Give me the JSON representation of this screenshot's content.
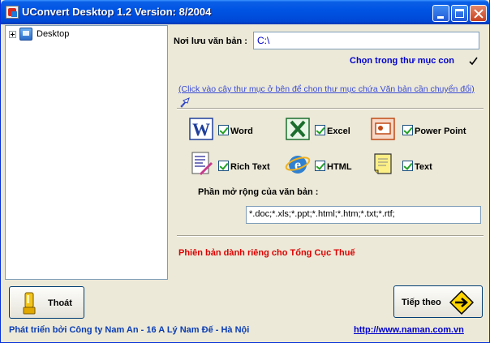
{
  "window": {
    "title": "UConvert Desktop 1.2   Version: 8/2004"
  },
  "tree": {
    "root_label": "Desktop"
  },
  "folder": {
    "label": "Nơi lưu văn bản :",
    "value": "C:\\",
    "subfolder_label": "Chọn trong thư mục con",
    "subfolder_checked": true
  },
  "hint": "(Click vào cây thư mục ở bên để chon thư mục chứa Văn bản cần chuyển đổi)",
  "file_types": [
    {
      "label": "Word",
      "icon": "word-icon",
      "checked": true
    },
    {
      "label": "Excel",
      "icon": "excel-icon",
      "checked": true
    },
    {
      "label": "Power Point",
      "icon": "powerpoint-icon",
      "checked": true
    },
    {
      "label": "Rich Text",
      "icon": "richtext-icon",
      "checked": true
    },
    {
      "label": "HTML",
      "icon": "html-icon",
      "checked": true
    },
    {
      "label": "Text",
      "icon": "text-icon",
      "checked": true
    }
  ],
  "extensions": {
    "label": "Phần mở rộng của văn bản :",
    "value": "*.doc;*.xls;*.ppt;*.html;*.htm;*.txt;*.rtf;"
  },
  "edition_note": "Phiên bản dành riêng cho Tổng Cục Thuế",
  "buttons": {
    "exit_label": "Thoát",
    "next_label": "Tiếp theo"
  },
  "footer": {
    "developer": "Phát triển bởi Công ty Nam An - 16 A Lý Nam Đế - Hà Nội",
    "url": "http://www.naman.com.vn"
  },
  "colors": {
    "titlebar": "#0054e3",
    "link": "#0000cc",
    "edition_note": "#dd0000",
    "window_bg": "#ece9d8"
  }
}
